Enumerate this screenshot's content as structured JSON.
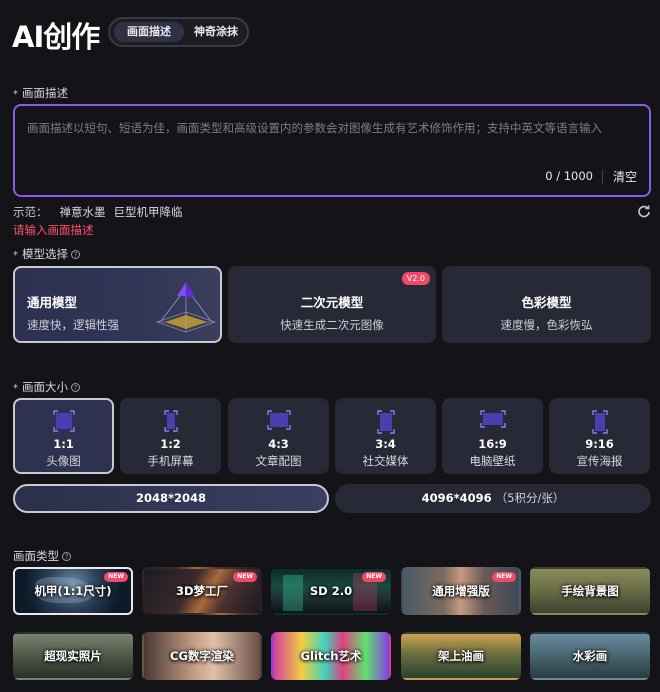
{
  "header": {
    "title": "AI创作",
    "tabs": [
      {
        "label": "画面描述",
        "active": true
      },
      {
        "label": "神奇涂抹",
        "active": false
      }
    ]
  },
  "description": {
    "label": "画面描述",
    "placeholder": "画面描述以短句、短语为佳，画面类型和高级设置内的参数会对图像生成有艺术修饰作用；支持中英文等语言输入",
    "value": "",
    "counter": "0 / 1000",
    "clear_label": "清空",
    "examples_label": "示范：",
    "examples": [
      "禅意水墨",
      "巨型机甲降临"
    ],
    "error": "请输入画面描述"
  },
  "model": {
    "label": "模型选择",
    "options": [
      {
        "name": "通用模型",
        "desc": "速度快，逻辑性强",
        "active": true,
        "badge": ""
      },
      {
        "name": "二次元模型",
        "desc": "快速生成二次元图像",
        "active": false,
        "badge": "V2.0"
      },
      {
        "name": "色彩模型",
        "desc": "速度慢，色彩恢弘",
        "active": false,
        "badge": ""
      }
    ]
  },
  "size": {
    "label": "画面大小",
    "ratios": [
      {
        "value": "1:1",
        "name": "头像图",
        "active": true
      },
      {
        "value": "1:2",
        "name": "手机屏幕",
        "active": false
      },
      {
        "value": "4:3",
        "name": "文章配图",
        "active": false
      },
      {
        "value": "3:4",
        "name": "社交媒体",
        "active": false
      },
      {
        "value": "16:9",
        "name": "电脑壁纸",
        "active": false
      },
      {
        "value": "9:16",
        "name": "宣传海报",
        "active": false
      }
    ],
    "resolutions": [
      {
        "label": "2048*2048",
        "sub": "",
        "active": true
      },
      {
        "label": "4096*4096",
        "sub": "（5积分/张）",
        "active": false
      }
    ]
  },
  "style": {
    "label": "画面类型",
    "new_badge": "NEW",
    "items": [
      {
        "label": "机甲(1:1尺寸)",
        "is_new": true,
        "active": true
      },
      {
        "label": "3D梦工厂",
        "is_new": true,
        "active": false
      },
      {
        "label": "SD 2.0",
        "is_new": true,
        "active": false
      },
      {
        "label": "通用增强版",
        "is_new": true,
        "active": false
      },
      {
        "label": "手绘背景图",
        "is_new": false,
        "active": false
      },
      {
        "label": "超现实照片",
        "is_new": false,
        "active": false
      },
      {
        "label": "CG数字渲染",
        "is_new": false,
        "active": false
      },
      {
        "label": "Glitch艺术",
        "is_new": false,
        "active": false
      },
      {
        "label": "架上油画",
        "is_new": false,
        "active": false
      },
      {
        "label": "水彩画",
        "is_new": false,
        "active": false
      }
    ]
  },
  "colors": {
    "accent_border": "#8a5ce6",
    "error": "#ff4f70",
    "badge": "#f04a68",
    "card_bg": "#272936",
    "page_bg": "#141418"
  }
}
